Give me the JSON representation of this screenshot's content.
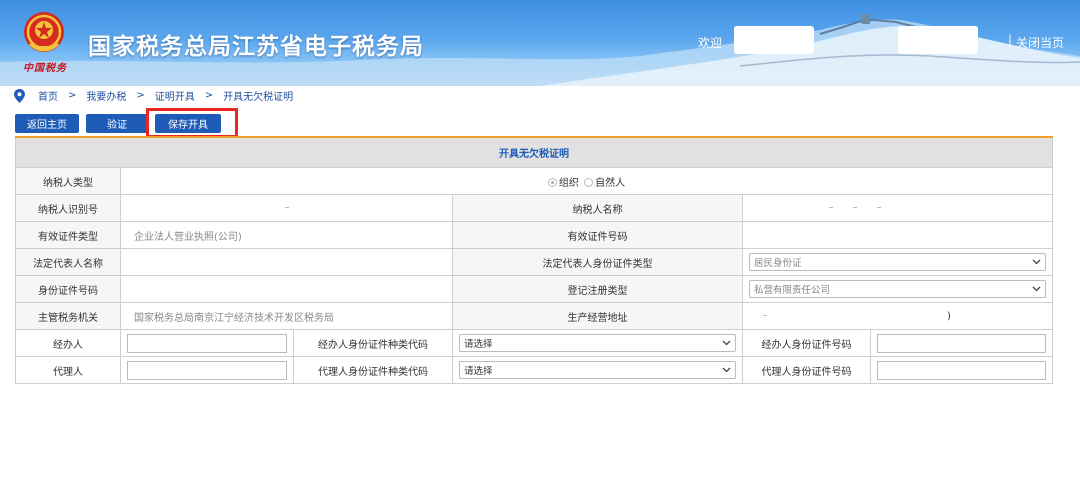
{
  "header": {
    "title": "国家税务总局江苏省电子税务局",
    "brand_sign": "中国税务",
    "welcome": "欢迎",
    "close_separator": "|",
    "close_label": "关闭当页"
  },
  "breadcrumb": {
    "items": [
      "首页",
      "我要办税",
      "证明开具",
      "开具无欠税证明"
    ],
    "separator": ">"
  },
  "toolbar": {
    "back_label": "返回主页",
    "verify_label": "验证",
    "save_label": "保存开具"
  },
  "form": {
    "title": "开具无欠税证明",
    "taxpayer_type_label": "纳税人类型",
    "taxpayer_type_options": [
      "组织",
      "自然人"
    ],
    "taxpayer_type_selected": "组织",
    "taxpayer_id_label": "纳税人识别号",
    "taxpayer_name_label": "纳税人名称",
    "cert_type_label": "有效证件类型",
    "cert_type_value": "企业法人营业执照(公司)",
    "cert_no_label": "有效证件号码",
    "legal_rep_label": "法定代表人名称",
    "legal_rep_id_type_label": "法定代表人身份证件类型",
    "legal_rep_id_type_value": "居民身份证",
    "id_no_label": "身份证件号码",
    "reg_type_label": "登记注册类型",
    "reg_type_value": "私营有限责任公司",
    "tax_authority_label": "主管税务机关",
    "tax_authority_value": "国家税务总局南京江宁经济技术开发区税务局",
    "business_address_label": "生产经营地址",
    "business_address_tail": ")",
    "handler_label": "经办人",
    "handler_id_type_label": "经办人身份证件种类代码",
    "handler_id_type_value": "请选择",
    "handler_id_no_label": "经办人身份证件号码",
    "agent_label": "代理人",
    "agent_id_type_label": "代理人身份证件种类代码",
    "agent_id_type_value": "请选择",
    "agent_id_no_label": "代理人身份证件号码"
  },
  "colors": {
    "primary_button": "#1e5cb8",
    "highlight_box": "#ea2720",
    "title_rule": "#f0a030"
  }
}
